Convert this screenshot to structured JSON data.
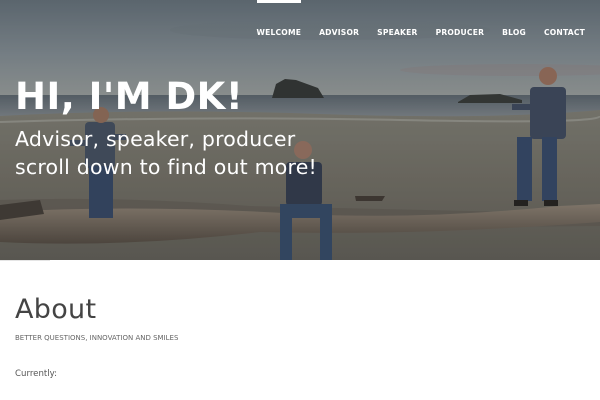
{
  "nav": {
    "items": [
      {
        "label": "WELCOME",
        "active": true
      },
      {
        "label": "ADVISOR",
        "active": false
      },
      {
        "label": "SPEAKER",
        "active": false
      },
      {
        "label": "PRODUCER",
        "active": false
      },
      {
        "label": "BLOG",
        "active": false
      },
      {
        "label": "CONTACT",
        "active": false
      }
    ]
  },
  "hero": {
    "title": "HI, I'M DK!",
    "line1": "Advisor, speaker, producer",
    "line2": "scroll down to find out more!"
  },
  "about": {
    "title": "About",
    "subtitle": "BETTER QUESTIONS, INNOVATION AND SMILES",
    "currently": "Currently:"
  },
  "colors": {
    "accent": "#ffffff",
    "heading": "#444444",
    "body_text": "#555555"
  }
}
